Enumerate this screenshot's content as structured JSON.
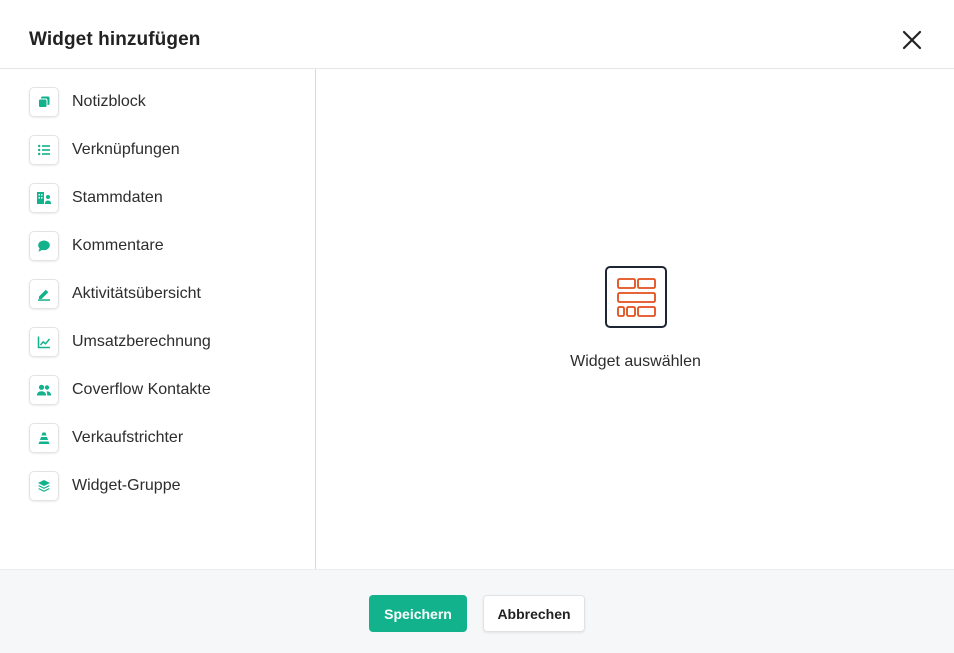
{
  "dialog": {
    "title": "Widget hinzufügen",
    "close_icon": "close-icon"
  },
  "colors": {
    "accent": "#12b28c",
    "placeholder_icon": "#e24e1b",
    "placeholder_frame": "#1f2633"
  },
  "sidebar": {
    "items": [
      {
        "label": "Notizblock",
        "icon": "notes-icon"
      },
      {
        "label": "Verknüpfungen",
        "icon": "list-icon"
      },
      {
        "label": "Stammdaten",
        "icon": "master-data-icon"
      },
      {
        "label": "Kommentare",
        "icon": "comment-icon"
      },
      {
        "label": "Aktivitätsübersicht",
        "icon": "edit-icon"
      },
      {
        "label": "Umsatzberechnung",
        "icon": "chart-icon"
      },
      {
        "label": "Coverflow Kontakte",
        "icon": "people-icon"
      },
      {
        "label": "Verkaufstrichter",
        "icon": "funnel-icon"
      },
      {
        "label": "Widget-Gruppe",
        "icon": "layers-icon"
      }
    ]
  },
  "main": {
    "placeholder_icon": "widget-layout-icon",
    "placeholder_text": "Widget auswählen"
  },
  "footer": {
    "save_label": "Speichern",
    "cancel_label": "Abbrechen"
  }
}
